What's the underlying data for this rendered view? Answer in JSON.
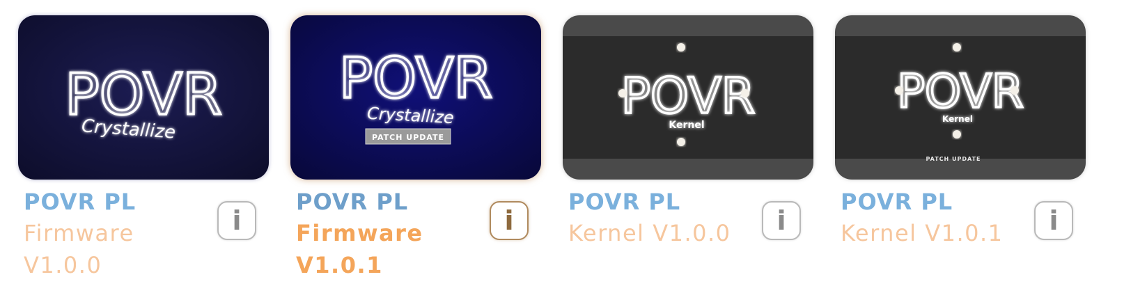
{
  "cards": [
    {
      "title": "POVR PL",
      "subtitle": "Firmware V1.0.0",
      "thumb": {
        "logo": "POVR",
        "sub_text": "Crystallize",
        "badge": ""
      },
      "info_icon": "info-icon",
      "selected": false
    },
    {
      "title": "POVR PL",
      "subtitle": "Firmware V1.0.1",
      "thumb": {
        "logo": "POVR",
        "sub_text": "Crystallize",
        "badge": "PATCH UPDATE"
      },
      "info_icon": "info-icon",
      "selected": true
    },
    {
      "title": "POVR PL",
      "subtitle": "Kernel V1.0.0",
      "thumb": {
        "logo": "POVR",
        "sub_text": "Kernel",
        "badge": ""
      },
      "info_icon": "info-icon",
      "selected": false
    },
    {
      "title": "POVR PL",
      "subtitle": "Kernel V1.0.1",
      "thumb": {
        "logo": "POVR",
        "sub_text": "Kernel",
        "badge": "PATCH UPDATE"
      },
      "info_icon": "info-icon",
      "selected": false
    }
  ],
  "info_glyph": "i",
  "colors": {
    "title": "#7ab0dc",
    "subtitle": "#f6c69d",
    "subtitle_selected": "#f4a55a",
    "selected_border": "#b08a5e"
  }
}
